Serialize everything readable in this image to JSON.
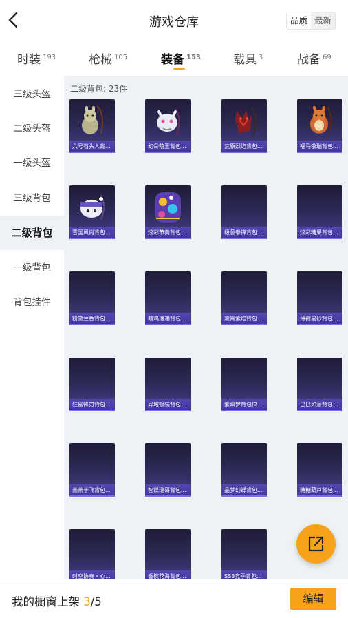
{
  "header": {
    "title": "游戏仓库",
    "sort_options": [
      "品质",
      "最新"
    ]
  },
  "tabs": [
    {
      "label": "时装",
      "count": "193"
    },
    {
      "label": "枪械",
      "count": "105"
    },
    {
      "label": "装备",
      "count": "153",
      "active": true
    },
    {
      "label": "载具",
      "count": "3"
    },
    {
      "label": "战备",
      "count": "69"
    }
  ],
  "sidebar": {
    "items": [
      {
        "label": "三级头盔"
      },
      {
        "label": "二级头盔"
      },
      {
        "label": "一级头盔"
      },
      {
        "label": "三级背包"
      },
      {
        "label": "二级背包",
        "active": true
      },
      {
        "label": "一级背包"
      },
      {
        "label": "背包挂件"
      }
    ]
  },
  "main": {
    "section_label": "二级背包: 23件",
    "items": [
      {
        "name": "六号石头人背...",
        "icon": "stone-man-backpack-icon"
      },
      {
        "name": "幻骨萌王背包...",
        "icon": "bone-king-backpack-icon"
      },
      {
        "name": "荒原烈焰背包...",
        "icon": "wasteland-flame-backpack-icon"
      },
      {
        "name": "福马敬瑞背包...",
        "icon": "horse-backpack-icon"
      },
      {
        "name": "雪国风尚背包...",
        "icon": "snow-backpack-icon"
      },
      {
        "name": "炫彩节奏背包...",
        "icon": "rhythm-backpack-icon"
      },
      {
        "name": "极意拳锋背包...",
        "icon": ""
      },
      {
        "name": "炫彩糖果背包...",
        "icon": ""
      },
      {
        "name": "粉黛兰香背包...",
        "icon": ""
      },
      {
        "name": "萌鸡速递背包...",
        "icon": ""
      },
      {
        "name": "凌霄紫焰背包...",
        "icon": ""
      },
      {
        "name": "薄荷星砂背包...",
        "icon": ""
      },
      {
        "name": "狂鲨锋刃背包...",
        "icon": ""
      },
      {
        "name": "异域银装背包...",
        "icon": ""
      },
      {
        "name": "紫幽梦背包(2...",
        "icon": ""
      },
      {
        "name": "巳巳如意背包...",
        "icon": ""
      },
      {
        "name": "燕燕于飞背包...",
        "icon": ""
      },
      {
        "name": "智谋瑞哥背包...",
        "icon": ""
      },
      {
        "name": "晶梦幻蝶背包...",
        "icon": ""
      },
      {
        "name": "糖糖葫芦背包...",
        "icon": ""
      },
      {
        "name": "时空协奏・心...",
        "icon": ""
      },
      {
        "name": "香槟花海背包...",
        "icon": ""
      },
      {
        "name": "SS8竞季背包...",
        "icon": ""
      }
    ]
  },
  "bottom": {
    "showcase_prefix": "我的橱窗上架 ",
    "showcase_current": "3",
    "showcase_total": "/5",
    "edit_label": "编辑"
  },
  "colors": {
    "accent": "#f7a21b",
    "card_label_bg": "#4a3fa8"
  }
}
